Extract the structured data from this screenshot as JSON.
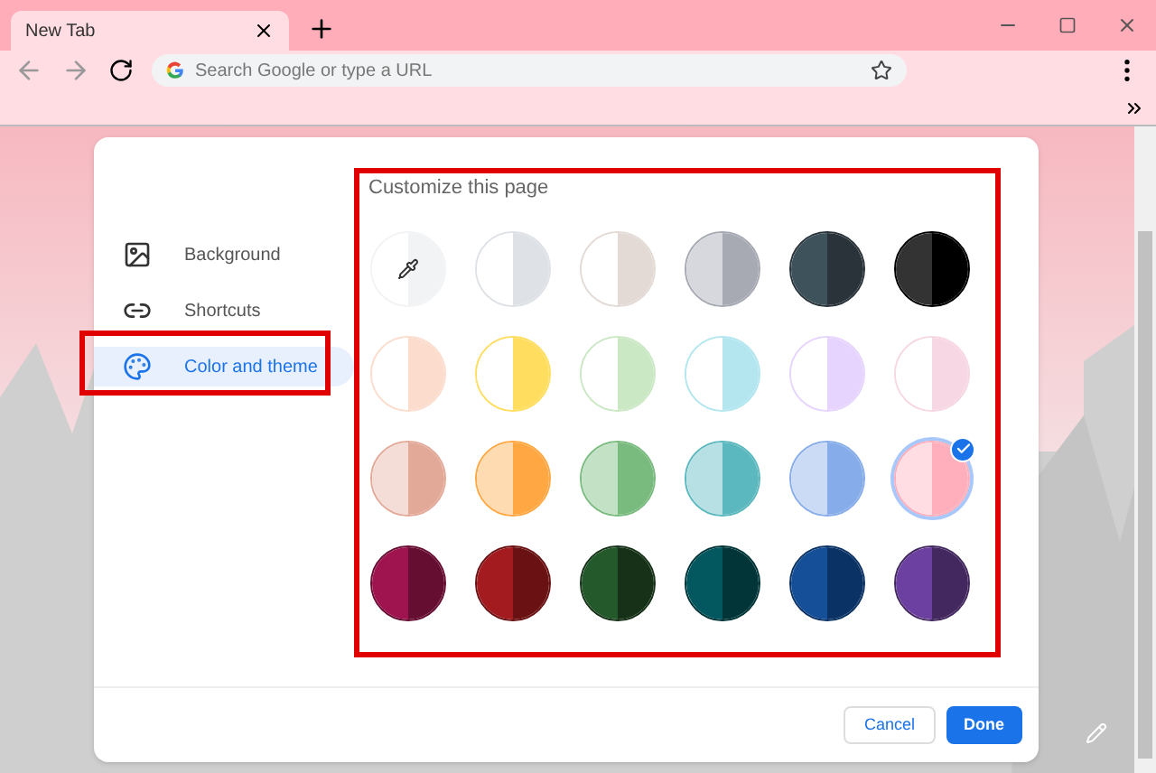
{
  "tab": {
    "title": "New Tab"
  },
  "omnibox": {
    "placeholder": "Search Google or type a URL"
  },
  "dialog": {
    "title": "Customize this page",
    "sidebar": [
      {
        "kind": "background",
        "label": "Background",
        "selected": false
      },
      {
        "kind": "shortcuts",
        "label": "Shortcuts",
        "selected": false
      },
      {
        "kind": "color",
        "label": "Color and theme",
        "selected": true
      }
    ],
    "themes": [
      {
        "kind": "custom",
        "halves": [
          {
            "color": "#ffffff"
          },
          {
            "color": "#f1f3f4"
          }
        ],
        "selected": false
      },
      {
        "kind": "preset",
        "halves": [
          {
            "color": "#ffffff"
          },
          {
            "color": "#dee1e6"
          }
        ],
        "selected": false
      },
      {
        "kind": "preset",
        "halves": [
          {
            "color": "#ffffff"
          },
          {
            "color": "#e3dad5"
          }
        ],
        "selected": false
      },
      {
        "kind": "preset",
        "halves": [
          {
            "color": "#d7d8dd"
          },
          {
            "color": "#a7aab3"
          }
        ],
        "selected": false
      },
      {
        "kind": "preset",
        "halves": [
          {
            "color": "#3e525c"
          },
          {
            "color": "#293339"
          }
        ],
        "selected": false
      },
      {
        "kind": "preset",
        "halves": [
          {
            "color": "#333333"
          },
          {
            "color": "#000000"
          }
        ],
        "selected": false
      },
      {
        "kind": "preset",
        "halves": [
          {
            "color": "#ffffff"
          },
          {
            "color": "#fcdccd"
          }
        ],
        "selected": false
      },
      {
        "kind": "preset",
        "halves": [
          {
            "color": "#ffffff"
          },
          {
            "color": "#ffde5f"
          }
        ],
        "selected": false
      },
      {
        "kind": "preset",
        "halves": [
          {
            "color": "#ffffff"
          },
          {
            "color": "#cbe8c4"
          }
        ],
        "selected": false
      },
      {
        "kind": "preset",
        "halves": [
          {
            "color": "#ffffff"
          },
          {
            "color": "#b3e6ef"
          }
        ],
        "selected": false
      },
      {
        "kind": "preset",
        "halves": [
          {
            "color": "#ffffff"
          },
          {
            "color": "#e7d4fe"
          }
        ],
        "selected": false
      },
      {
        "kind": "preset",
        "halves": [
          {
            "color": "#ffffff"
          },
          {
            "color": "#f6d7e3"
          }
        ],
        "selected": false
      },
      {
        "kind": "preset",
        "halves": [
          {
            "color": "#f4ddd7"
          },
          {
            "color": "#e3a998"
          }
        ],
        "selected": false
      },
      {
        "kind": "preset",
        "halves": [
          {
            "color": "#fedbb0"
          },
          {
            "color": "#ffa843"
          }
        ],
        "selected": false
      },
      {
        "kind": "preset",
        "halves": [
          {
            "color": "#c3e1c5"
          },
          {
            "color": "#79bb7e"
          }
        ],
        "selected": false
      },
      {
        "kind": "preset",
        "halves": [
          {
            "color": "#b6e0e3"
          },
          {
            "color": "#5bb8be"
          }
        ],
        "selected": false
      },
      {
        "kind": "preset",
        "halves": [
          {
            "color": "#cbdbf6"
          },
          {
            "color": "#86acea"
          }
        ],
        "selected": false
      },
      {
        "kind": "preset",
        "halves": [
          {
            "color": "#ffdde2"
          },
          {
            "color": "#ffafbb"
          }
        ],
        "selected": true
      },
      {
        "kind": "preset",
        "halves": [
          {
            "color": "#9f134f"
          },
          {
            "color": "#660d32"
          }
        ],
        "selected": false
      },
      {
        "kind": "preset",
        "halves": [
          {
            "color": "#a31a1f"
          },
          {
            "color": "#6a1213"
          }
        ],
        "selected": false
      },
      {
        "kind": "preset",
        "halves": [
          {
            "color": "#245a2b"
          },
          {
            "color": "#163118"
          }
        ],
        "selected": false
      },
      {
        "kind": "preset",
        "halves": [
          {
            "color": "#03585f"
          },
          {
            "color": "#013538"
          }
        ],
        "selected": false
      },
      {
        "kind": "preset",
        "halves": [
          {
            "color": "#154f97"
          },
          {
            "color": "#0b3264"
          }
        ],
        "selected": false
      },
      {
        "kind": "preset",
        "halves": [
          {
            "color": "#6c40a0"
          },
          {
            "color": "#42285f"
          }
        ],
        "selected": false
      }
    ],
    "buttons": [
      {
        "kind": "secondary",
        "label": "Cancel"
      },
      {
        "kind": "primary",
        "label": "Done"
      }
    ]
  }
}
